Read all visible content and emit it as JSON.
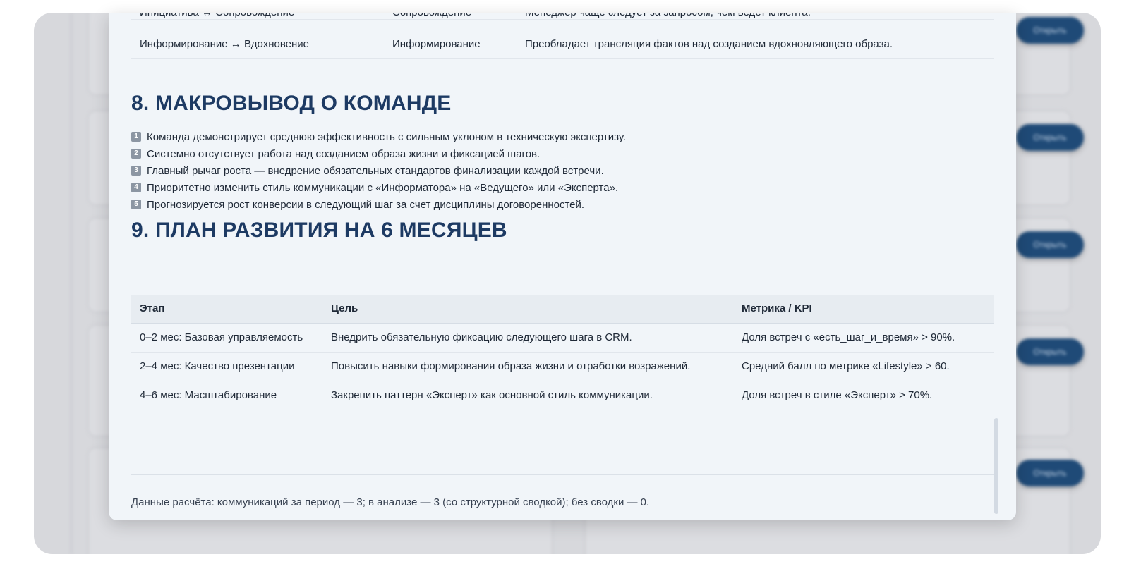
{
  "background_app": {
    "open_button_label": "Открыть",
    "button_color": "#1f4a77"
  },
  "modal": {
    "top_table": {
      "rows": [
        {
          "shift": "Инициатива ↔ Сопровождение",
          "dominant": "Сопровождение",
          "comment": "Менеджер чаще следует за запросом, чем ведет клиента."
        },
        {
          "shift": "Информирование ↔ Вдохновение",
          "dominant": "Информирование",
          "comment": "Преобладает трансляция фактов над созданием вдохновляющего образа."
        }
      ]
    },
    "section8": {
      "title": "8. МАКРОВЫВОД О КОМАНДЕ",
      "items": [
        {
          "num": "1",
          "text": "Команда демонстрирует среднюю эффективность с сильным уклоном в техническую экспертизу."
        },
        {
          "num": "2",
          "text": "Системно отсутствует работа над созданием образа жизни и фиксацией шагов."
        },
        {
          "num": "3",
          "text": "Главный рычаг роста — внедрение обязательных стандартов финализации каждой встречи."
        },
        {
          "num": "4",
          "text": "Приоритетно изменить стиль коммуникации с «Информатора» на «Ведущего» или «Эксперта»."
        },
        {
          "num": "5",
          "text": "Прогнозируется рост конверсии в следующий шаг за счет дисциплины договоренностей."
        }
      ]
    },
    "section9": {
      "title": "9. ПЛАН РАЗВИТИЯ НА 6 МЕСЯЦЕВ",
      "headers": {
        "stage": "Этап",
        "goal": "Цель",
        "metric": "Метрика / KPI"
      },
      "rows": [
        {
          "stage": "0–2 мес: Базовая управляемость",
          "goal": "Внедрить обязательную фиксацию следующего шага в CRM.",
          "metric": "Доля встреч с «есть_шаг_и_время» > 90%."
        },
        {
          "stage": "2–4 мес: Качество презентации",
          "goal": "Повысить навыки формирования образа жизни и отработки возражений.",
          "metric": "Средний балл по метрике «Lifestyle» > 60."
        },
        {
          "stage": "4–6 мес: Масштабирование",
          "goal": "Закрепить паттерн «Эксперт» как основной стиль коммуникации.",
          "metric": "Доля встреч в стиле «Эксперт» > 70%."
        }
      ]
    },
    "footer_note": "Данные расчёта: коммуникаций за период — 3; в анализе — 3 (со структурной сводкой); без сводки — 0.",
    "accent_color": "#1d3a63"
  }
}
